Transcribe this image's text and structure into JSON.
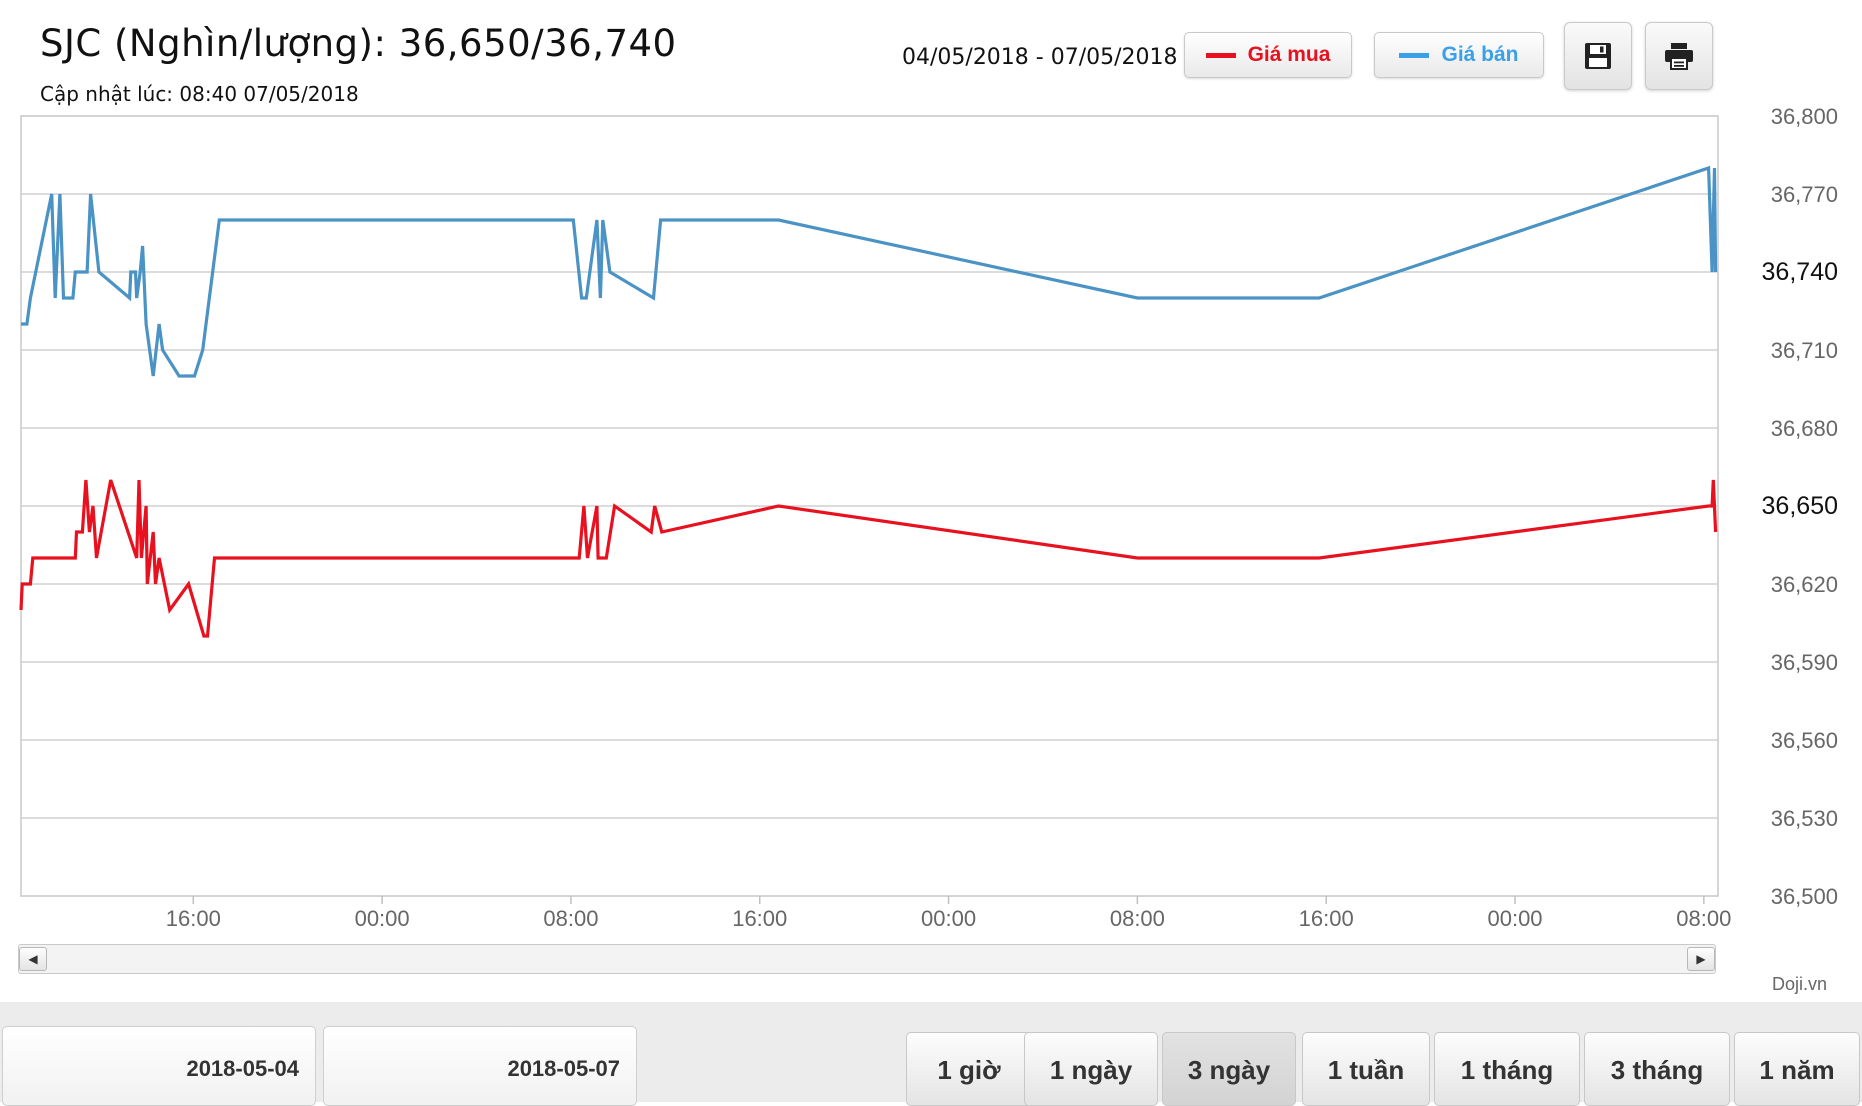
{
  "header": {
    "title": "SJC (Nghìn/lượng): 36,650/36,740",
    "updated": "Cập nhật lúc: 08:40 07/05/2018",
    "date_range": "04/05/2018 - 07/05/2018"
  },
  "legend": {
    "buy_label": "Giá mua",
    "sell_label": "Giá bán"
  },
  "toolbar": {
    "save_icon": "floppy-disk-icon",
    "print_icon": "printer-icon"
  },
  "colors": {
    "buy": "#e8111f",
    "sell": "#4a93c4",
    "sell_legend_text": "#3aa0e8",
    "grid": "#d0d0d0"
  },
  "chart_data": {
    "type": "line",
    "x_unit": "hours since 2018-05-04 00:00",
    "x_ticks": [
      {
        "x": 16,
        "label": "16:00"
      },
      {
        "x": 24,
        "label": "00:00"
      },
      {
        "x": 32,
        "label": "08:00"
      },
      {
        "x": 40,
        "label": "16:00"
      },
      {
        "x": 48,
        "label": "00:00"
      },
      {
        "x": 56,
        "label": "08:00"
      },
      {
        "x": 64,
        "label": "16:00"
      },
      {
        "x": 72,
        "label": "00:00"
      },
      {
        "x": 80,
        "label": "08:00"
      }
    ],
    "xlim": [
      8.7,
      80.6
    ],
    "ylim": [
      36500,
      36800
    ],
    "y_ticks": [
      36500,
      36530,
      36560,
      36590,
      36620,
      36650,
      36680,
      36710,
      36740,
      36770,
      36800
    ],
    "y_tick_labels": [
      "36,500",
      "36,530",
      "36,560",
      "36,590",
      "36,620",
      "36,650",
      "36,680",
      "36,710",
      "36,740",
      "36,770",
      "36,800"
    ],
    "y_highlight_labels": [
      "36,740",
      "36,650"
    ],
    "grid": true,
    "legend_position": "top-right",
    "series": [
      {
        "name": "Giá bán",
        "points": [
          [
            8.7,
            36720
          ],
          [
            8.95,
            36720
          ],
          [
            9.1,
            36730
          ],
          [
            10.0,
            36770
          ],
          [
            10.15,
            36730
          ],
          [
            10.35,
            36770
          ],
          [
            10.5,
            36730
          ],
          [
            10.9,
            36730
          ],
          [
            11.0,
            36740
          ],
          [
            11.3,
            36740
          ],
          [
            11.5,
            36740
          ],
          [
            11.65,
            36770
          ],
          [
            12.0,
            36740
          ],
          [
            13.3,
            36730
          ],
          [
            13.35,
            36740
          ],
          [
            13.55,
            36740
          ],
          [
            13.6,
            36730
          ],
          [
            13.75,
            36740
          ],
          [
            13.85,
            36750
          ],
          [
            14.0,
            36720
          ],
          [
            14.3,
            36700
          ],
          [
            14.55,
            36720
          ],
          [
            14.7,
            36710
          ],
          [
            15.4,
            36700
          ],
          [
            16.05,
            36700
          ],
          [
            16.4,
            36710
          ],
          [
            17.1,
            36760
          ],
          [
            32.1,
            36760
          ],
          [
            32.45,
            36730
          ],
          [
            32.65,
            36730
          ],
          [
            33.1,
            36760
          ],
          [
            33.25,
            36730
          ],
          [
            33.35,
            36760
          ],
          [
            33.65,
            36740
          ],
          [
            35.5,
            36730
          ],
          [
            35.8,
            36760
          ],
          [
            40.8,
            36760
          ],
          [
            56.0,
            36730
          ],
          [
            63.7,
            36730
          ],
          [
            80.2,
            36780
          ],
          [
            80.35,
            36740
          ],
          [
            80.45,
            36780
          ],
          [
            80.5,
            36740
          ]
        ]
      },
      {
        "name": "Giá mua",
        "points": [
          [
            8.7,
            36610
          ],
          [
            8.75,
            36620
          ],
          [
            9.1,
            36620
          ],
          [
            9.2,
            36630
          ],
          [
            10.2,
            36630
          ],
          [
            11.0,
            36630
          ],
          [
            11.05,
            36640
          ],
          [
            11.3,
            36640
          ],
          [
            11.45,
            36660
          ],
          [
            11.6,
            36640
          ],
          [
            11.75,
            36650
          ],
          [
            11.9,
            36630
          ],
          [
            12.1,
            36640
          ],
          [
            12.5,
            36660
          ],
          [
            13.6,
            36630
          ],
          [
            13.7,
            36660
          ],
          [
            13.8,
            36630
          ],
          [
            14.0,
            36650
          ],
          [
            14.05,
            36620
          ],
          [
            14.3,
            36640
          ],
          [
            14.4,
            36620
          ],
          [
            14.55,
            36630
          ],
          [
            15.0,
            36610
          ],
          [
            15.8,
            36620
          ],
          [
            16.45,
            36600
          ],
          [
            16.6,
            36600
          ],
          [
            16.9,
            36630
          ],
          [
            32.35,
            36630
          ],
          [
            32.55,
            36650
          ],
          [
            32.7,
            36630
          ],
          [
            33.1,
            36650
          ],
          [
            33.15,
            36630
          ],
          [
            33.5,
            36630
          ],
          [
            33.85,
            36650
          ],
          [
            35.4,
            36640
          ],
          [
            35.55,
            36650
          ],
          [
            35.85,
            36640
          ],
          [
            40.8,
            36650
          ],
          [
            56.0,
            36630
          ],
          [
            63.7,
            36630
          ],
          [
            80.2,
            36650
          ],
          [
            80.35,
            36650
          ],
          [
            80.4,
            36660
          ],
          [
            80.5,
            36640
          ]
        ]
      }
    ]
  },
  "scrollbar": {
    "left_arrow": "◀",
    "right_arrow": "▶"
  },
  "credit": "Doji.vn",
  "date_inputs": {
    "from": "2018-05-04",
    "to": "2018-05-07"
  },
  "ranges": [
    {
      "label": "1 giờ",
      "active": false
    },
    {
      "label": "1 ngày",
      "active": false
    },
    {
      "label": "3 ngày",
      "active": true
    },
    {
      "label": "1 tuần",
      "active": false
    },
    {
      "label": "1 tháng",
      "active": false
    },
    {
      "label": "3 tháng",
      "active": false
    },
    {
      "label": "1 năm",
      "active": false
    }
  ]
}
